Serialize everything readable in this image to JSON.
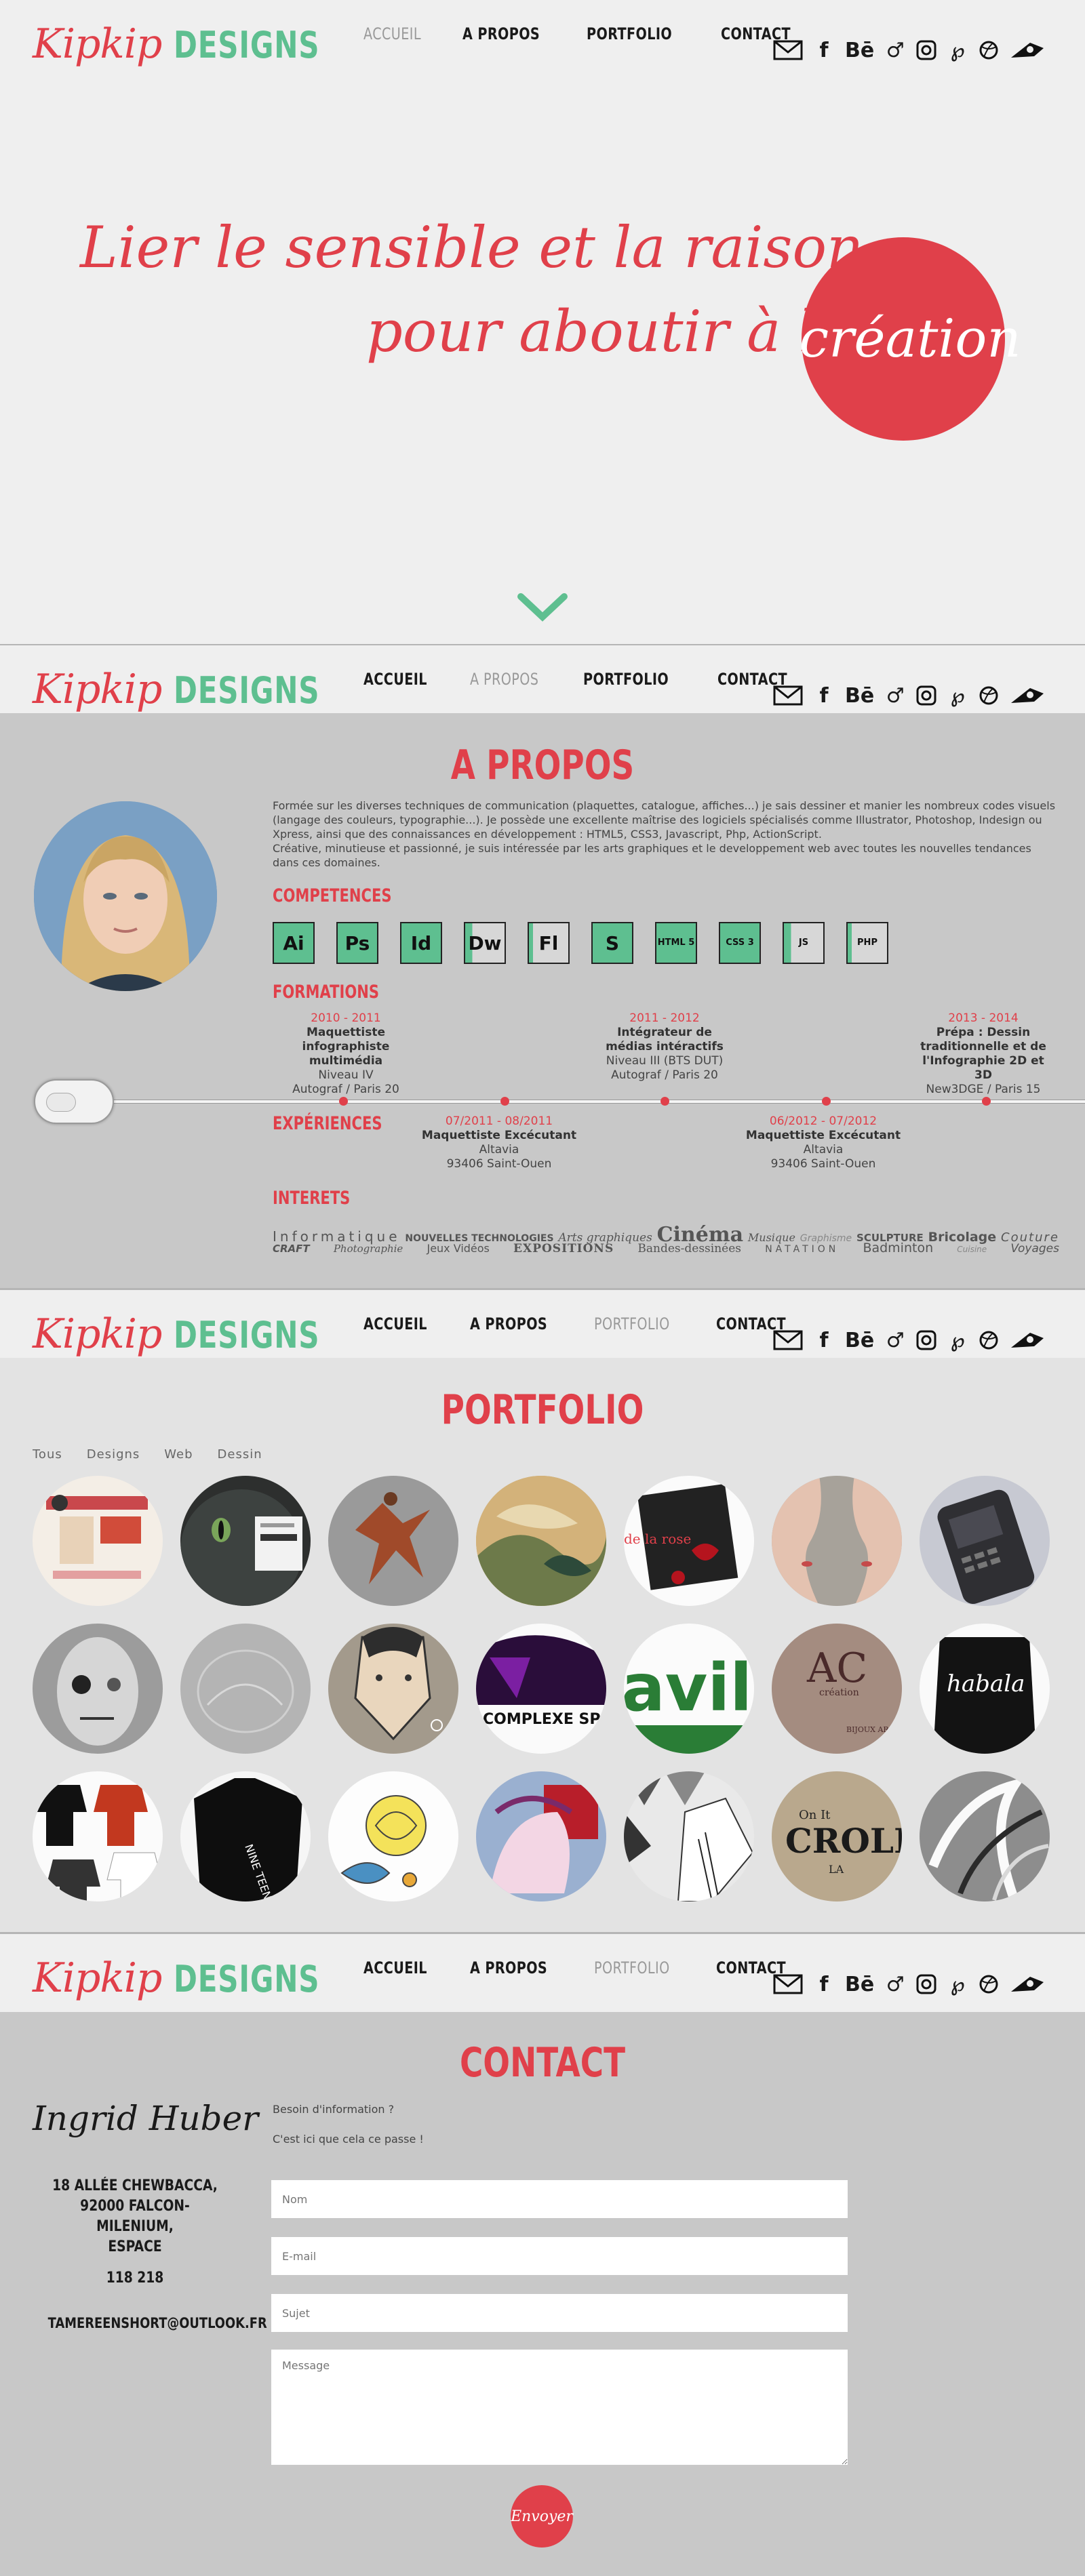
{
  "brand": {
    "script": "Kipkip",
    "caps": "DESIGNS"
  },
  "nav": {
    "accueil": "ACCUEIL",
    "apropos": "A PROPOS",
    "portfolio": "PORTFOLIO",
    "contact": "CONTACT"
  },
  "social_icons": [
    "mail-icon",
    "facebook-icon",
    "behance-icon",
    "music-icon",
    "instagram-icon",
    "pinterest-icon",
    "dribbble-icon",
    "deviantart-icon"
  ],
  "hero": {
    "line1": "Lier le sensible et la raison",
    "line2": "pour aboutir à la",
    "circle": "création"
  },
  "about": {
    "title": "A PROPOS",
    "text": "Formée sur les diverses techniques de communication (plaquettes, catalogue, affiches...) je sais dessiner et manier les nombreux codes visuels (langage des couleurs, typographie...). Je possède une excellente maîtrise des logiciels spécialisés comme Illustrator, Photoshop, Indesign ou Xpress, ainsi que des connaissances en développement : HTML5, CSS3, Javascript, Php, ActionScript.",
    "text2": "Créative, minutieuse et passionné, je suis intéressée par les arts graphiques et le developpement web avec toutes les nouvelles tendances dans ces domaines.",
    "competences_title": "COMPETENCES",
    "skills": [
      "Ai",
      "Ps",
      "Id",
      "Dw",
      "Fl",
      "S",
      "HTML 5",
      "CSS 3",
      "JS",
      "PHP"
    ],
    "formations_title": "FORMATIONS",
    "formations": [
      {
        "date": "2010 - 2011",
        "title": "Maquettiste infographiste multimédia",
        "level": "Niveau IV",
        "place": "Autograf / Paris 20"
      },
      {
        "date": "2011 - 2012",
        "title": "Intégrateur de médias intéractifs",
        "level": "Niveau III (BTS DUT)",
        "place": "Autograf / Paris 20"
      },
      {
        "date": "2013 - 2014",
        "title": "Prépa : Dessin traditionnelle et de l'Infographie 2D et 3D",
        "level": "",
        "place": "New3DGE / Paris 15"
      }
    ],
    "experiences_title": "EXPÉRIENCES",
    "experiences": [
      {
        "date": "07/2011 - 08/2011",
        "title": "Maquettiste Excécutant",
        "company": "Altavia",
        "place": "93406 Saint-Ouen"
      },
      {
        "date": "06/2012 - 07/2012",
        "title": "Maquettiste Excécutant",
        "company": "Altavia",
        "place": "93406 Saint-Ouen"
      }
    ],
    "interets_title": "INTERETS",
    "interests_row1": [
      "Informatique",
      "NOUVELLES TECHNOLOGIES",
      "Arts graphiques",
      "Cinéma",
      "Musique",
      "Graphisme",
      "SCULPTURE",
      "Bricolage",
      "Couture"
    ],
    "interests_row2": [
      "CRAFT",
      "Photographie",
      "Jeux Vidéos",
      "EXPOSITIONS",
      "Bandes-dessinées",
      "NATATION",
      "Badminton",
      "Cuisine",
      "Voyages"
    ]
  },
  "portfolio": {
    "title": "PORTFOLIO",
    "filters": [
      "Tous",
      "Designs",
      "Web",
      "Dessin"
    ],
    "thumb_texts": {
      "rose": "de la rose",
      "complexe": "COMPLEXE SPO",
      "avil": "avil",
      "ac": "AC",
      "ac_sub": "création",
      "ac_bottom": "BIJOUX ARGENT",
      "kabala": "habala",
      "nineteen": "NINE TEEN",
      "crolf": "CROLF",
      "crolf_top": "On It",
      "crolf_bottom": "LA"
    }
  },
  "contact": {
    "title": "CONTACT",
    "name": "Ingrid Huber",
    "address": [
      "18 ALLÉE CHEWBACCA,",
      "92000 FALCON-MILENIUM,",
      "ESPACE"
    ],
    "phone": "118 218",
    "email": "TAMEREENSHORT@OUTLOOK.FR",
    "intro1": "Besoin d'information ?",
    "intro2": "C'est ici que cela ce passe !",
    "nom_placeholder": "Nom",
    "email_placeholder": "E-mail",
    "sujet_placeholder": "Sujet",
    "message_placeholder": "Message",
    "send_label": "Envoyer"
  },
  "colors": {
    "accent_red": "#e0404a",
    "accent_green": "#5ebf90"
  }
}
